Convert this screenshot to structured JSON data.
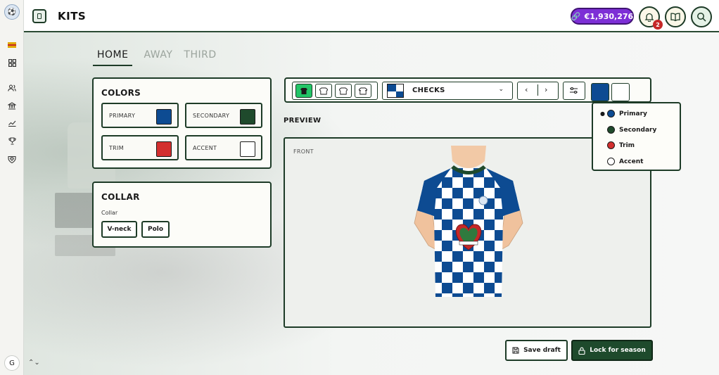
{
  "header": {
    "title": "KITS",
    "balance": "€1,930,276",
    "notification_count": "2"
  },
  "sidebar": {
    "avatar_initial": "G",
    "icons": [
      "flag-icon",
      "dashboard-icon",
      "people-icon",
      "bank-icon",
      "chart-icon",
      "trophy-icon",
      "shield-heart-icon"
    ]
  },
  "tabs": [
    {
      "label": "HOME",
      "active": true
    },
    {
      "label": "AWAY",
      "active": false
    },
    {
      "label": "THIRD",
      "active": false
    }
  ],
  "colors_panel": {
    "title": "COLORS",
    "items": [
      {
        "label": "PRIMARY",
        "color": "#0d4b92"
      },
      {
        "label": "SECONDARY",
        "color": "#1f4a2c"
      },
      {
        "label": "TRIM",
        "color": "#d32f2f"
      },
      {
        "label": "ACCENT",
        "color": "#ffffff"
      }
    ]
  },
  "collar_panel": {
    "title": "COLLAR",
    "sub_label": "Collar",
    "options": [
      "V-neck",
      "Polo"
    ]
  },
  "toolbar": {
    "pattern": "CHECKS",
    "swatch_1": "#0d4b92",
    "swatch_2": "#ffffff"
  },
  "preview": {
    "label": "PREVIEW",
    "view": "FRONT"
  },
  "color_menu": {
    "items": [
      {
        "label": "Primary",
        "color": "#0d4b92",
        "selected": true
      },
      {
        "label": "Secondary",
        "color": "#1f4a2c",
        "selected": false
      },
      {
        "label": "Trim",
        "color": "#d32f2f",
        "selected": false
      },
      {
        "label": "Accent",
        "color": "#ffffff",
        "selected": false
      }
    ]
  },
  "actions": {
    "save": "Save draft",
    "lock": "Lock for season"
  }
}
